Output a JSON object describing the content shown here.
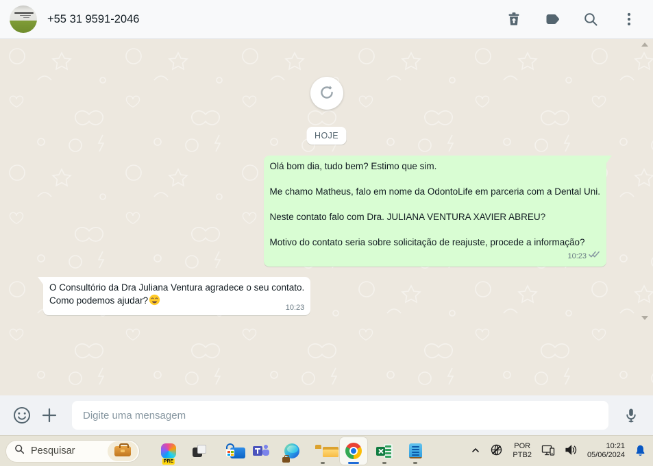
{
  "header": {
    "contact_name": "+55 31 9591-2046"
  },
  "chat": {
    "date_divider": "HOJE",
    "messages": [
      {
        "direction": "outgoing",
        "paragraphs": [
          "Olá bom dia, tudo bem? Estimo que sim.",
          "Me chamo Matheus, falo em nome da OdontoLife em parceria com a Dental Uni.",
          "Neste contato falo com Dra. JULIANA VENTURA XAVIER ABREU?",
          "Motivo do contato seria sobre solicitação de reajuste, procede a informação?"
        ],
        "time": "10:23",
        "status": "delivered-double-check"
      },
      {
        "direction": "incoming",
        "paragraphs": [
          "O Consultório da Dra Juliana Ventura agradece o seu contato.",
          "Como podemos ajudar?"
        ],
        "emoji": "😊",
        "time": "10:23"
      }
    ]
  },
  "composer": {
    "placeholder": "Digite uma mensagem"
  },
  "taskbar": {
    "search_label": "Pesquisar",
    "copilot_badge": "PRE",
    "language_line1": "POR",
    "language_line2": "PTB2",
    "time": "10:21",
    "date": "05/06/2024"
  },
  "colors": {
    "outgoing_bubble": "#d9fdd3",
    "incoming_bubble": "#ffffff",
    "chat_background": "#ede8df",
    "header_icon": "#54656f",
    "meta_text": "#667781",
    "checkmark": "#8696a0",
    "taskbar_background": "#e7e4d7",
    "active_app_indicator": "#1e6bd6",
    "notification_bell": "#0857c3"
  }
}
